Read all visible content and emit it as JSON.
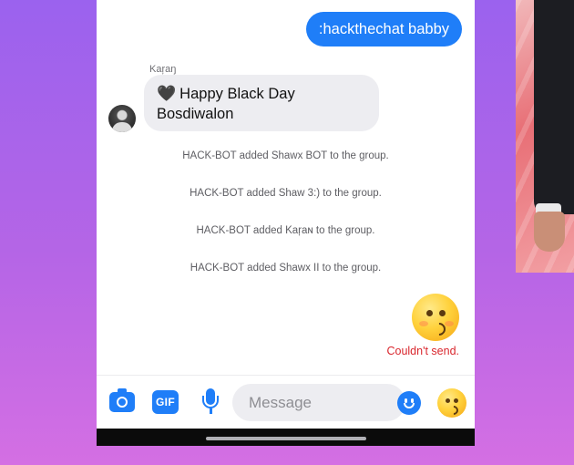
{
  "chat": {
    "sent_message": ":hackthechat babby",
    "sender_name": "Kaŗaŋ",
    "received_message": "Happy Black Day Bosdiwalon",
    "heart_emoji": "🖤",
    "system_messages": [
      "HACK-BOT added Shawx BOT to the group.",
      "HACK-BOT added Shaw 3:) to the group.",
      "HACK-BOT added Kaŗaɴ to the group.",
      "HACK-BOT added Shawx II to the group."
    ],
    "big_emoji": "kissing-face",
    "send_error": "Couldn't send."
  },
  "input_bar": {
    "gif_label": "GIF",
    "message_placeholder": "Message",
    "icons": [
      "camera-icon",
      "gif-icon",
      "mic-icon",
      "smile-icon",
      "emoji-icon"
    ]
  },
  "colors": {
    "accent": "#1f7ef8",
    "error": "#d9262d",
    "background_top": "#9b62ee",
    "background_bottom": "#d46fe3"
  }
}
